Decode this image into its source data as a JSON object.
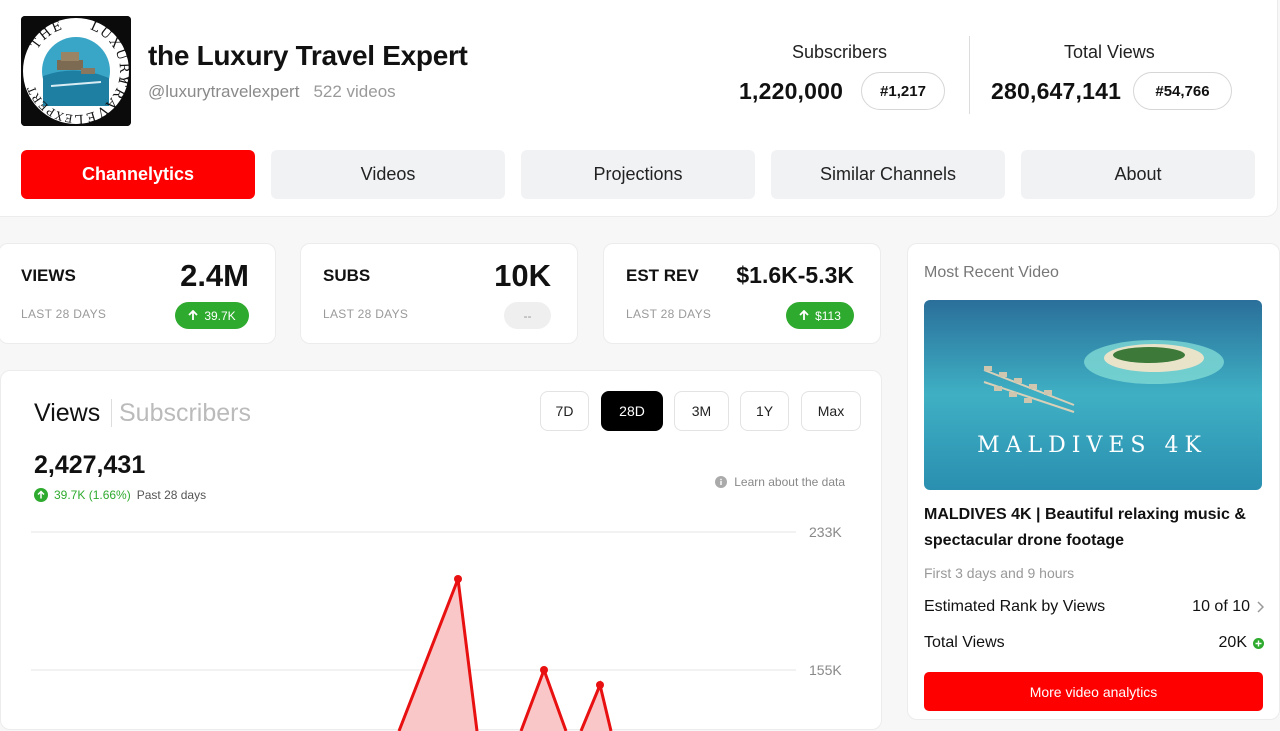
{
  "channel": {
    "name": "the Luxury Travel Expert",
    "handle": "@luxurytravelexpert",
    "videos": "522 videos",
    "avatar_text_top": "LUXURY",
    "avatar_text_left": "THE",
    "avatar_text_right": "TRAVEL",
    "avatar_text_bottom": "EXPERT"
  },
  "stats": {
    "subscribers_label": "Subscribers",
    "subscribers_value": "1,220,000",
    "subscribers_rank": "#1,217",
    "views_label": "Total Views",
    "views_value": "280,647,141",
    "views_rank": "#54,766"
  },
  "tabs": [
    "Channelytics",
    "Videos",
    "Projections",
    "Similar Channels",
    "About"
  ],
  "metrics": [
    {
      "label": "VIEWS",
      "value": "2.4M",
      "period": "LAST 28 DAYS",
      "change": "39.7K"
    },
    {
      "label": "SUBS",
      "value": "10K",
      "period": "LAST 28 DAYS",
      "change": "--"
    },
    {
      "label": "EST REV",
      "value": "$1.6K-5.3K",
      "period": "LAST 28 DAYS",
      "change": "$113"
    }
  ],
  "chart_panel": {
    "tab_views": "Views",
    "tab_subscribers": "Subscribers",
    "ranges": [
      "7D",
      "28D",
      "3M",
      "1Y",
      "Max"
    ],
    "active_range": "28D",
    "total": "2,427,431",
    "change": "39.7K (1.66%)",
    "period": "Past 28 days",
    "learn": "Learn about the data"
  },
  "chart_data": {
    "type": "area",
    "title": "",
    "xlabel": "",
    "ylabel": "",
    "y_ticks": [
      "233K",
      "155K"
    ],
    "peaks": [
      {
        "index": 12,
        "value": 206000
      },
      {
        "index": 15,
        "value": 155000
      },
      {
        "index": 17,
        "value": 150000
      }
    ],
    "color": "#e81010"
  },
  "recent": {
    "section_title": "Most Recent Video",
    "thumb_text": "MALDIVES 4K",
    "title": "MALDIVES 4K | Beautiful relaxing music & spectacular drone footage",
    "age": "First 3 days and 9 hours",
    "rank_label": "Estimated Rank by Views",
    "rank_value": "10 of 10",
    "views_label": "Total Views",
    "views_value": "20K",
    "button": "More video analytics"
  },
  "colors": {
    "brand": "#ff0000",
    "positive": "#2eaa2e"
  }
}
